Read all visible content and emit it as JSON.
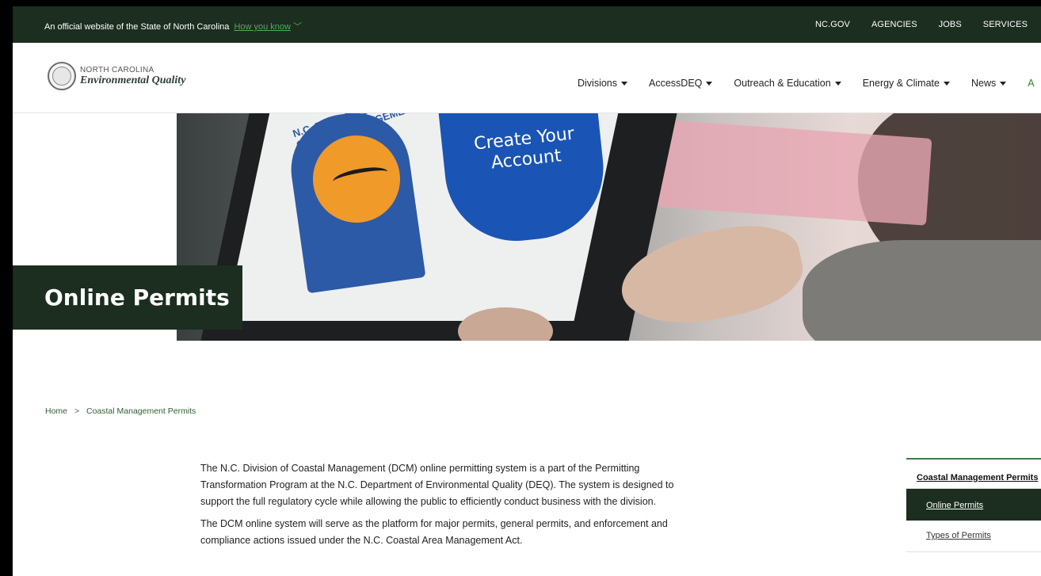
{
  "topbar": {
    "official_text": "An official website of the State of North Carolina",
    "how_you_know": "How you know",
    "links": [
      "NC.GOV",
      "AGENCIES",
      "JOBS",
      "SERVICES"
    ]
  },
  "header": {
    "logo_line1": "NORTH CAROLINA",
    "logo_line2": "Environmental Quality",
    "nav": [
      "Divisions",
      "AccessDEQ",
      "Outreach & Education",
      "Energy & Climate",
      "News"
    ],
    "nav_cut": "A"
  },
  "hero": {
    "badge_text": "N.C. DIVISION OF COASTAL MANAGEMENT",
    "create_line1": "Create Your",
    "create_line2": "Account",
    "page_title": "Online Permits"
  },
  "breadcrumb": {
    "home": "Home",
    "separator": ">",
    "current": "Coastal Management Permits"
  },
  "content": {
    "paragraphs": [
      "The N.C. Division of Coastal Management (DCM) online permitting system is a part of the Permitting Transformation Program at the N.C. Department of Environmental Quality (DEQ). The system is designed to support the full regulatory cycle while allowing the public to efficiently conduct business with the division.",
      "The DCM online system will serve as the platform for major permits, general permits, and enforcement and compliance actions issued under the N.C. Coastal Area Management Act."
    ]
  },
  "sidebar": {
    "heading": "Coastal Management Permits",
    "items": [
      "Online Permits",
      "Types of Permits"
    ]
  }
}
